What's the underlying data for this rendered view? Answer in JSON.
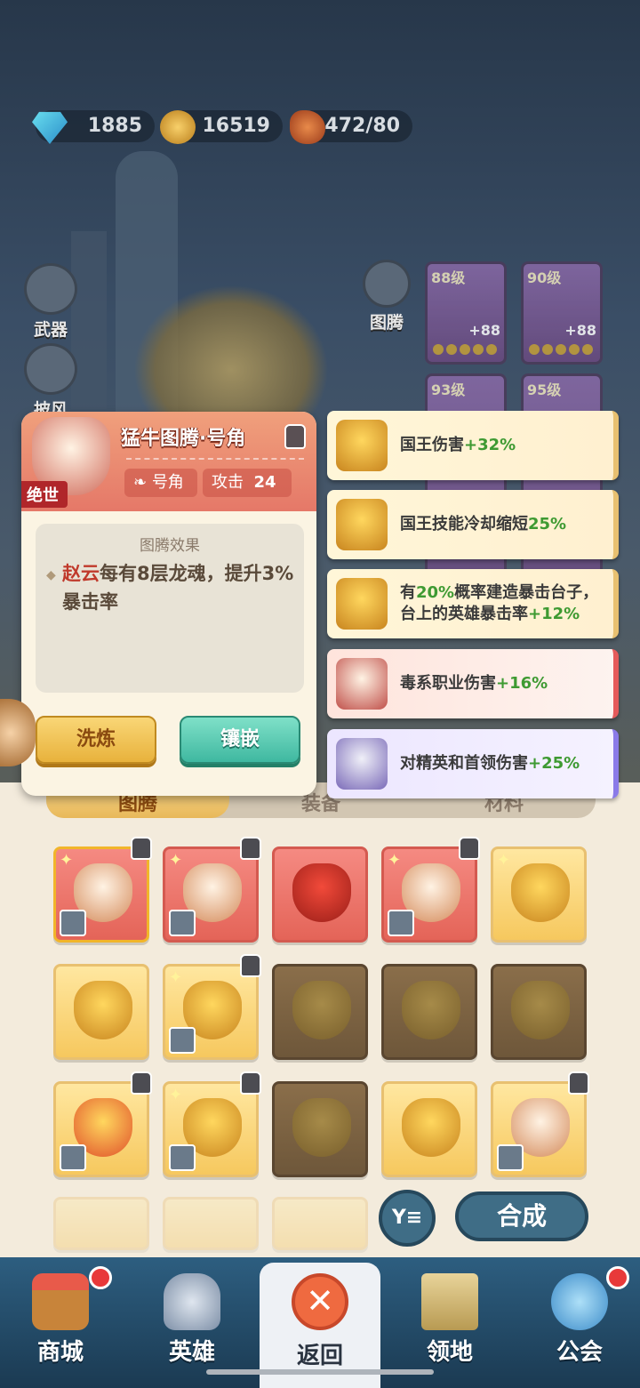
{
  "resources": {
    "gems": "1885",
    "gold": "16519",
    "stamina": "472/80"
  },
  "side_buttons": {
    "weapon": "武器",
    "cape": "披风",
    "totem": "图腾"
  },
  "equip_slots": [
    {
      "level": "88级",
      "bonus": "+88"
    },
    {
      "level": "90级",
      "bonus": "+88"
    },
    {
      "level": "93级",
      "bonus": ""
    },
    {
      "level": "95级",
      "bonus": ""
    }
  ],
  "card": {
    "title": "猛牛图腾·号角",
    "rarity": "绝世",
    "type_label": "号角",
    "attack_label": "攻击",
    "attack_value": "24",
    "effect_title": "图腾效果",
    "effect_hero": "赵云",
    "effect_text": "每有8层龙魂，提升3%暴击率",
    "wash_button": "洗炼",
    "inlay_button": "镶嵌"
  },
  "buffs": [
    {
      "text": "国王伤害",
      "value": "+32%",
      "icon": "bull-totem-icon"
    },
    {
      "text": "国王技能冷却缩短",
      "value": "25%",
      "icon": "bull-totem-icon"
    },
    {
      "text_pre": "有",
      "value_pre": "20%",
      "text": "概率建造暴击台子，台上的英雄暴击率",
      "value": "+12%",
      "icon": "bull-totem-icon"
    },
    {
      "text": "毒系职业伤害",
      "value": "+16%",
      "icon": "red-bull-totem-icon"
    },
    {
      "text": "对精英和首领伤害",
      "value": "+25%",
      "icon": "purple-totem-icon"
    }
  ],
  "tabs": [
    "图腾",
    "装备",
    "材料"
  ],
  "actions": {
    "filter": "Y≡",
    "compose": "合成"
  },
  "nav": {
    "shop": "商城",
    "hero": "英雄",
    "back": "返回",
    "territory": "领地",
    "guild": "公会"
  },
  "colors": {
    "accent_green": "#3e9a32",
    "highlight_red": "#c0392b",
    "nav_blue": "#2d5e80"
  }
}
